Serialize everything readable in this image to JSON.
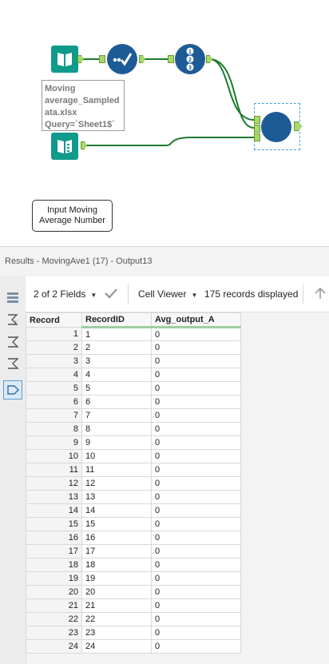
{
  "canvas": {
    "input_tool_annotation": "Moving\naverage_Sampled\nata.xlsx\nQuery=`Sheet1$`",
    "comment_text": "Input Moving\nAverage Number",
    "colors": {
      "input": "#0f9a8c",
      "tool": "#1d5b96",
      "anchor": "#a6d86a",
      "wire": "#1e7a2e",
      "selection": "#4aa3df"
    }
  },
  "results": {
    "title": "Results - MovingAve1 (17) - Output13",
    "fields_label": "2 of 2 Fields",
    "viewer_label": "Cell Viewer",
    "records_label": "175 records displayed",
    "columns": [
      "Record",
      "RecordID",
      "Avg_output_A"
    ],
    "rows": [
      [
        "1",
        "1",
        "0"
      ],
      [
        "2",
        "2",
        "0"
      ],
      [
        "3",
        "3",
        "0"
      ],
      [
        "4",
        "4",
        "0"
      ],
      [
        "5",
        "5",
        "0"
      ],
      [
        "6",
        "6",
        "0"
      ],
      [
        "7",
        "7",
        "0"
      ],
      [
        "8",
        "8",
        "0"
      ],
      [
        "9",
        "9",
        "0"
      ],
      [
        "10",
        "10",
        "0"
      ],
      [
        "11",
        "11",
        "0"
      ],
      [
        "12",
        "12",
        "0"
      ],
      [
        "13",
        "13",
        "0"
      ],
      [
        "14",
        "14",
        "0"
      ],
      [
        "15",
        "15",
        "0"
      ],
      [
        "16",
        "16",
        "0"
      ],
      [
        "17",
        "17",
        "0"
      ],
      [
        "18",
        "18",
        "0"
      ],
      [
        "19",
        "19",
        "0"
      ],
      [
        "20",
        "20",
        "0"
      ],
      [
        "21",
        "21",
        "0"
      ],
      [
        "22",
        "22",
        "0"
      ],
      [
        "23",
        "23",
        "0"
      ],
      [
        "24",
        "24",
        "0"
      ]
    ],
    "side_icons": [
      "list-icon",
      "sum-tag-icon",
      "sum-icon",
      "sum-icon-alt",
      "tag-icon"
    ]
  }
}
